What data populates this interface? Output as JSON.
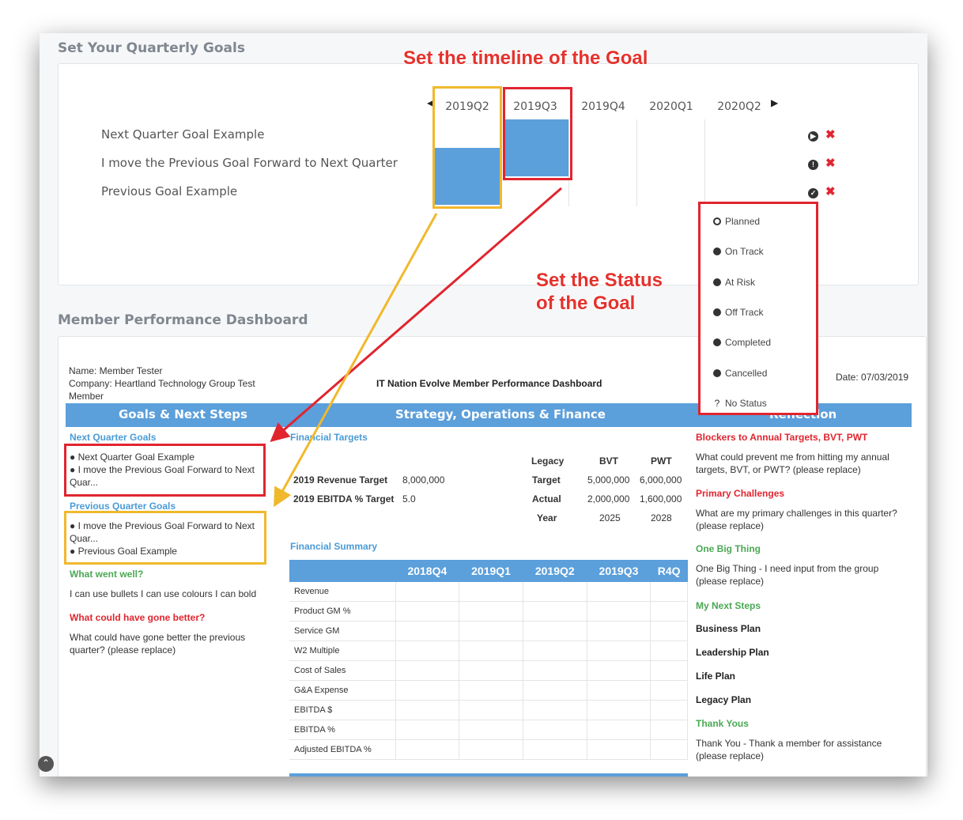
{
  "sections": {
    "quarterly_goals_title": "Set Your Quarterly Goals",
    "dashboard_title": "Member Performance Dashboard"
  },
  "quarters": [
    "2019Q2",
    "2019Q3",
    "2019Q4",
    "2020Q1",
    "2020Q2"
  ],
  "goals": [
    {
      "label": "Next Quarter Goal Example",
      "status_icon": "play-circle-icon",
      "remove": "✖"
    },
    {
      "label": "I move the Previous Goal Forward to Next Quarter",
      "status_icon": "exclamation-circle-icon",
      "remove": "✖"
    },
    {
      "label": "Previous Goal Example",
      "status_icon": "check-circle-icon",
      "remove": "✖"
    }
  ],
  "status_menu": [
    "Planned",
    "On Track",
    "At Risk",
    "Off Track",
    "Completed",
    "Cancelled",
    "No Status"
  ],
  "annotations": {
    "timeline": "Set the timeline of the Goal",
    "status_line1": "Set the Status",
    "status_line2": "of the Goal"
  },
  "dashboard": {
    "name": "Name: Member Tester",
    "company": "Company: Heartland Technology Group Test Member",
    "report_title": "IT Nation Evolve Member Performance Dashboard",
    "date": "Date: 07/03/2019",
    "col_headers": [
      "Goals & Next Steps",
      "Strategy, Operations & Finance",
      "Reflection"
    ],
    "next_quarter_goals_title": "Next Quarter Goals",
    "next_quarter_goals": [
      "Next Quarter Goal Example",
      "I move the Previous Goal Forward to Next Quar..."
    ],
    "previous_quarter_goals_title": "Previous Quarter Goals",
    "previous_quarter_goals": [
      "I move the Previous Goal Forward to Next Quar...",
      "Previous Goal Example"
    ],
    "went_well_title": "What went well?",
    "went_well_text": "I can use bullets I can use colours I can bold",
    "could_be_better_title": "What could have gone better?",
    "could_be_better_text": "What could have gone better the previous quarter? (please replace)",
    "financial_targets_title": "Financial Targets",
    "ft_headers": [
      "Legacy",
      "BVT",
      "PWT"
    ],
    "revenue_label": "2019 Revenue Target",
    "revenue_value": "8,000,000",
    "ebitda_label": "2019 EBITDA % Target",
    "ebitda_value": "5.0",
    "target_row": {
      "label": "Target",
      "bvt": "5,000,000",
      "pwt": "6,000,000"
    },
    "actual_row": {
      "label": "Actual",
      "bvt": "2,000,000",
      "pwt": "1,600,000"
    },
    "year_row": {
      "label": "Year",
      "bvt": "2025",
      "pwt": "2028"
    },
    "financial_summary_title": "Financial Summary",
    "fs_columns": [
      "2018Q4",
      "2019Q1",
      "2019Q2",
      "2019Q3",
      "R4Q"
    ],
    "fs_rows": [
      "Revenue",
      "Product GM %",
      "Service GM",
      "W2 Multiple",
      "Cost of Sales",
      "G&A Expense",
      "EBITDA $",
      "EBITDA %",
      "Adjusted EBITDA %"
    ],
    "blockers_title": "Blockers to Annual Targets, BVT, PWT",
    "blockers_text": "What could prevent me from hitting my annual targets, BVT, or PWT? (please replace)",
    "challenges_title": "Primary Challenges",
    "challenges_text": "What are my primary challenges in this quarter? (please replace)",
    "big_thing_title": "One Big Thing",
    "big_thing_text": "One Big Thing - I need input from the group (please replace)",
    "next_steps_title": "My Next Steps",
    "next_steps": [
      "Business Plan",
      "Leadership Plan",
      "Life Plan",
      "Legacy Plan"
    ],
    "thank_yous_title": "Thank Yous",
    "thank_yous_text": "Thank You - Thank a member for assistance (please replace)"
  },
  "colors": {
    "accent_blue": "#5b9fdb",
    "annotation_red": "#e0252f",
    "annotation_yellow": "#f0b92c",
    "green": "#4aa853"
  }
}
